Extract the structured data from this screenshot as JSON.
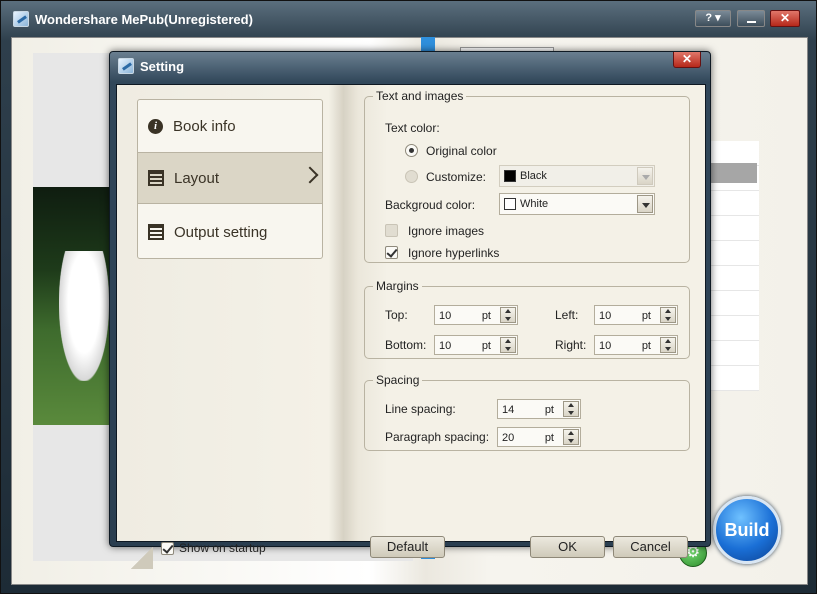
{
  "app": {
    "title": "Wondershare MePub(Unregistered)",
    "help_label": "? ▾",
    "close_label": "✕",
    "build_label": "Build",
    "gear_label": "⚙"
  },
  "dialog": {
    "title": "Setting",
    "close_label": "✕",
    "nav": {
      "items": [
        {
          "label": "Book info",
          "icon": "info-icon"
        },
        {
          "label": "Layout",
          "icon": "layout-icon",
          "active": true
        },
        {
          "label": "Output setting",
          "icon": "output-icon"
        }
      ]
    },
    "show_on_startup": {
      "label": "Show on startup",
      "checked": true
    },
    "text_and_images": {
      "legend": "Text and images",
      "text_color_label": "Text color:",
      "original_color_label": "Original color",
      "customize_label": "Customize:",
      "customize_value": "Black",
      "background_label": "Backgroud color:",
      "background_value": "White",
      "ignore_images_label": "Ignore images",
      "ignore_hyperlinks_label": "Ignore hyperlinks"
    },
    "margins": {
      "legend": "Margins",
      "top_label": "Top:",
      "top_value": "10",
      "left_label": "Left:",
      "left_value": "10",
      "bottom_label": "Bottom:",
      "bottom_value": "10",
      "right_label": "Right:",
      "right_value": "10",
      "unit": "pt"
    },
    "spacing": {
      "legend": "Spacing",
      "line_label": "Line spacing:",
      "line_value": "14",
      "paragraph_label": "Paragraph spacing:",
      "paragraph_value": "20",
      "unit": "pt"
    },
    "buttons": {
      "default": "Default",
      "ok": "OK",
      "cancel": "Cancel"
    }
  },
  "colors": {
    "swatch_black": "#000000",
    "swatch_white": "#ffffff",
    "build_blue": "#1a6fd6"
  }
}
